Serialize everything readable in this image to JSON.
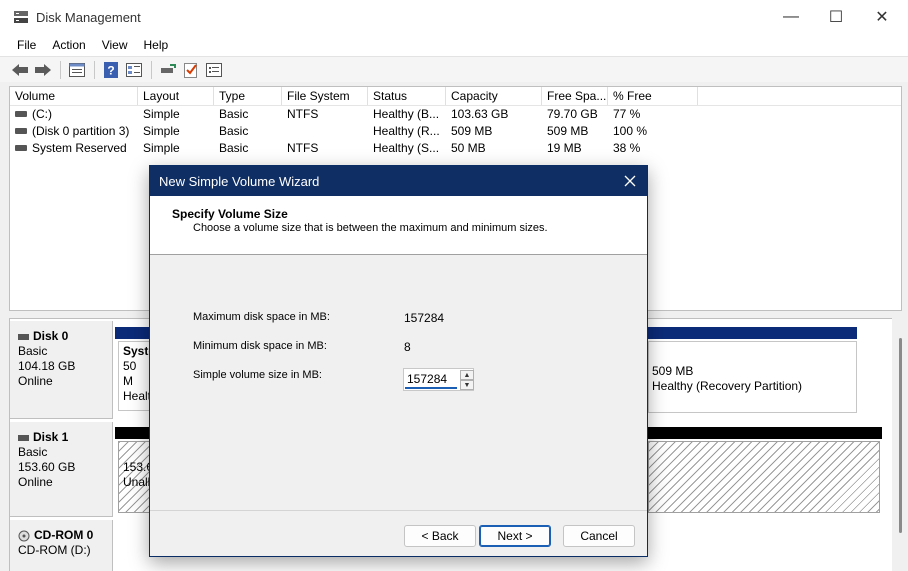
{
  "window": {
    "title": "Disk Management",
    "minimize": "—",
    "maximize": "☐",
    "close": "✕"
  },
  "menu": [
    "File",
    "Action",
    "View",
    "Help"
  ],
  "toolbar": {
    "icons": [
      "back-arrow-icon",
      "forward-arrow-icon",
      "properties-icon",
      "help-icon",
      "list-view-icon",
      "connect-disk-icon",
      "check-icon",
      "settings-panel-icon"
    ]
  },
  "volume_list": {
    "columns": [
      "Volume",
      "Layout",
      "Type",
      "File System",
      "Status",
      "Capacity",
      "Free Spa...",
      "% Free"
    ],
    "rows": [
      [
        "(C:)",
        "Simple",
        "Basic",
        "NTFS",
        "Healthy (B...",
        "103.63 GB",
        "79.70 GB",
        "77 %"
      ],
      [
        "(Disk 0 partition 3)",
        "Simple",
        "Basic",
        "",
        "Healthy (R...",
        "509 MB",
        "509 MB",
        "100 %"
      ],
      [
        "System Reserved",
        "Simple",
        "Basic",
        "NTFS",
        "Healthy (S...",
        "50 MB",
        "19 MB",
        "38 %"
      ]
    ]
  },
  "disks": {
    "disk0": {
      "name": "Disk 0",
      "type": "Basic",
      "size": "104.18 GB",
      "state": "Online"
    },
    "disk1": {
      "name": "Disk 1",
      "type": "Basic",
      "size": "153.60 GB",
      "state": "Online"
    },
    "cdrom": {
      "name": "CD-ROM 0",
      "type": "CD-ROM (D:)"
    }
  },
  "partitions": {
    "system_reserved": {
      "line1": "Syste",
      "line2": "50 M",
      "line3": "Healt"
    },
    "recovery": {
      "line1": "509 MB",
      "line2": "Healthy (Recovery Partition)"
    },
    "unallocated": {
      "line1": "153.60",
      "line2": "Unall"
    }
  },
  "dialog": {
    "title": "New Simple Volume Wizard",
    "heading": "Specify Volume Size",
    "subheading": "Choose a volume size that is between the maximum and minimum sizes.",
    "max_label": "Maximum disk space in MB:",
    "max_value": "157284",
    "min_label": "Minimum disk space in MB:",
    "min_value": "8",
    "size_label": "Simple volume size in MB:",
    "size_value": "157284",
    "back": "< Back",
    "next": "Next >",
    "cancel": "Cancel"
  },
  "colors": {
    "dialog_title": "#0f2e64",
    "partition_bar": "#0b2a78",
    "focus": "#1a5fb4"
  }
}
